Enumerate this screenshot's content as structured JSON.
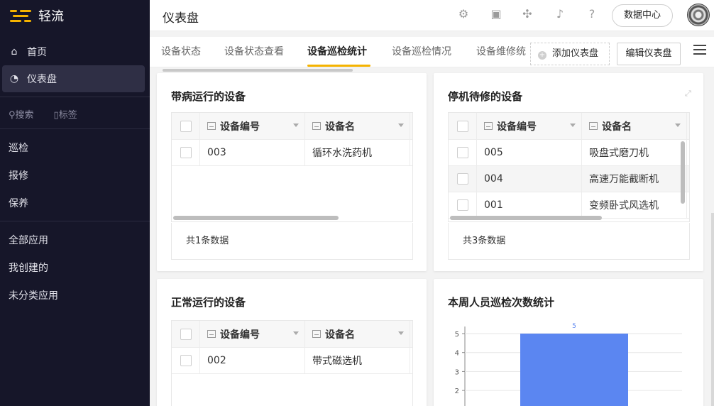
{
  "app": {
    "brand": "轻流"
  },
  "sidebar": {
    "nav": [
      {
        "label": "首页",
        "icon": "home-icon"
      },
      {
        "label": "仪表盘",
        "icon": "dashboard-icon"
      }
    ],
    "search_label": "搜索",
    "tag_label": "标签",
    "group1": [
      "巡检",
      "报修",
      "保养"
    ],
    "group2": [
      "全部应用",
      "我创建的",
      "未分类应用"
    ]
  },
  "header": {
    "title": "仪表盘",
    "icons": [
      "gear-icon",
      "inbox-icon",
      "puzzle-icon",
      "bell-icon",
      "help-icon"
    ],
    "data_center_label": "数据中心"
  },
  "tabs": {
    "items": [
      "设备状态",
      "设备状态查看",
      "设备巡检统计",
      "设备巡检情况",
      "设备维修统"
    ],
    "active_index": 2,
    "add_label": "添加仪表盘",
    "edit_label": "编辑仪表盘"
  },
  "cards": {
    "sick": {
      "title": "带病运行的设备",
      "columns": [
        "设备编号",
        "设备名"
      ],
      "rows": [
        {
          "id": "003",
          "name": "循环水洗药机"
        }
      ],
      "footer": "共1条数据"
    },
    "stopped": {
      "title": "停机待修的设备",
      "columns": [
        "设备编号",
        "设备名"
      ],
      "rows": [
        {
          "id": "005",
          "name": "吸盘式磨刀机"
        },
        {
          "id": "004",
          "name": "高速万能截断机"
        },
        {
          "id": "001",
          "name": "变频卧式风选机"
        }
      ],
      "footer": "共3条数据"
    },
    "normal": {
      "title": "正常运行的设备",
      "columns": [
        "设备编号",
        "设备名"
      ],
      "rows": [
        {
          "id": "002",
          "name": "带式磁选机"
        }
      ]
    },
    "weekly": {
      "title": "本周人员巡检次数统计"
    }
  },
  "chart_data": {
    "type": "bar",
    "title": "本周人员巡检次数统计",
    "categories": [
      ""
    ],
    "values": [
      5
    ],
    "data_labels": [
      "5"
    ],
    "y_ticks": [
      2,
      3,
      4,
      5
    ],
    "ylim": [
      0,
      5.5
    ],
    "bar_color": "#5b86f1",
    "grid": true
  }
}
